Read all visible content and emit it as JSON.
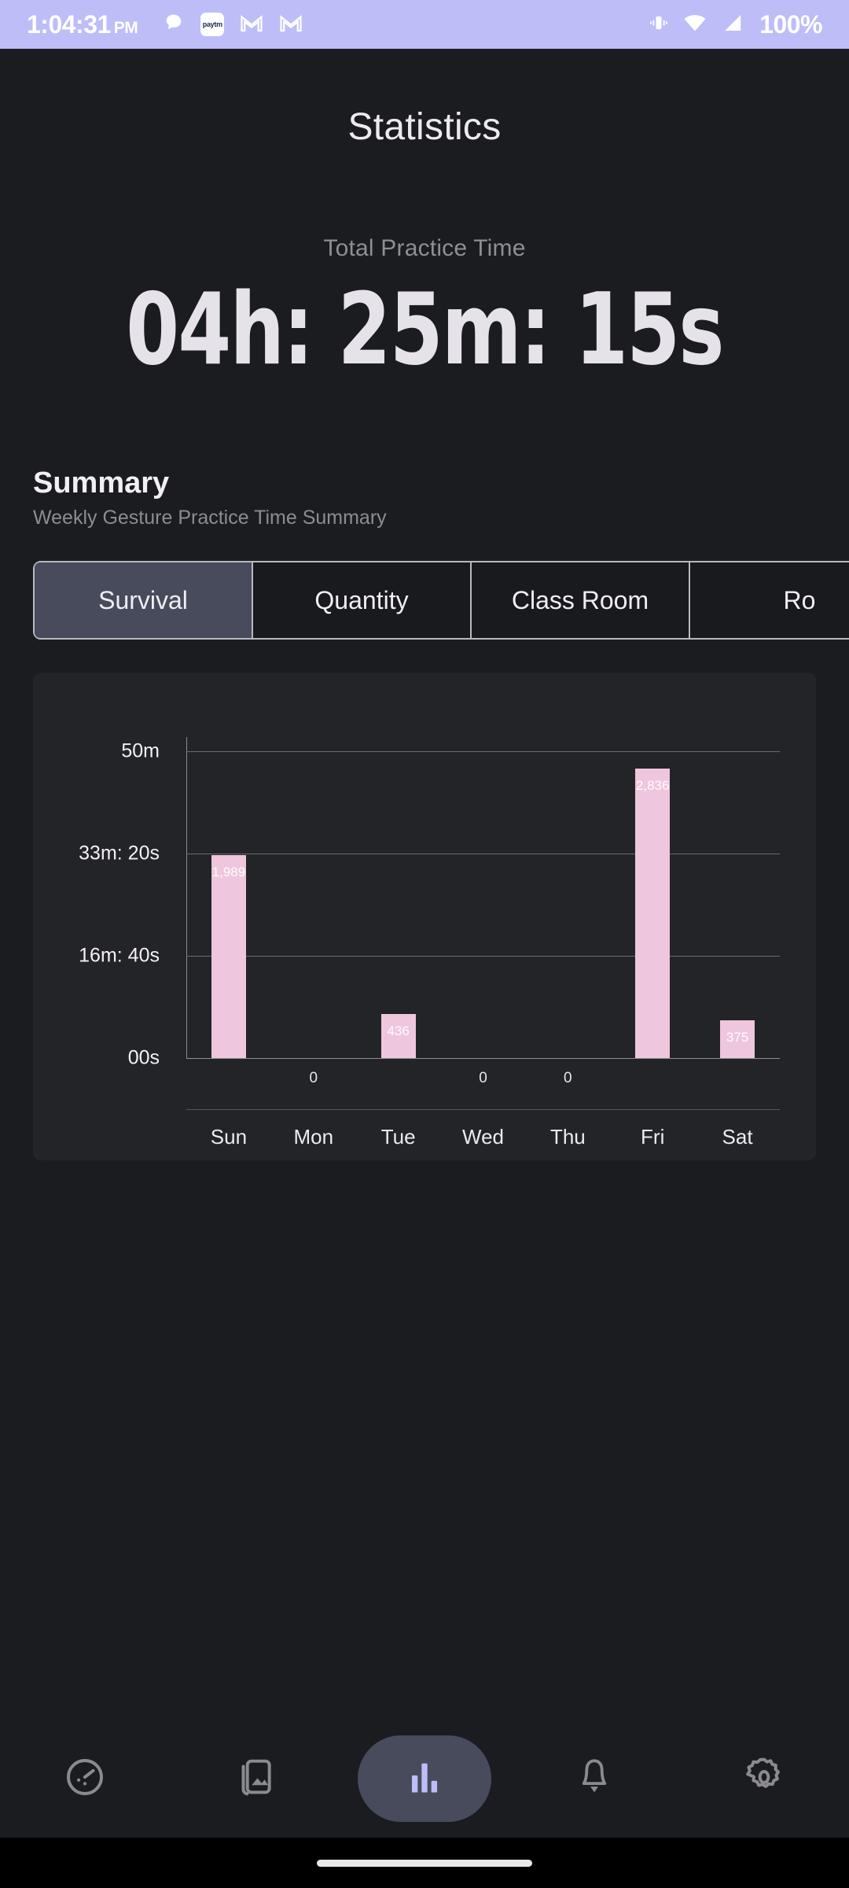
{
  "status_bar": {
    "time": "1:04:31",
    "ampm": "PM",
    "battery": "100%",
    "background_color": "#bdbdf8",
    "icons_left": [
      "chat-bubble-icon",
      "paytm-icon",
      "gmail-icon",
      "gmail-icon"
    ],
    "paytm_label": "paytm",
    "icons_right": [
      "vibrate-icon",
      "wifi-icon",
      "signal-icon"
    ]
  },
  "header": {
    "title": "Statistics"
  },
  "total_practice": {
    "label": "Total Practice Time",
    "value": "04h: 25m: 15s"
  },
  "summary": {
    "title": "Summary",
    "subtitle": "Weekly Gesture Practice Time Summary",
    "tabs": [
      {
        "label": "Survival",
        "active": true
      },
      {
        "label": "Quantity",
        "active": false
      },
      {
        "label": "Class Room",
        "active": false
      },
      {
        "label": "Ro",
        "active": false
      }
    ]
  },
  "chart_data": {
    "type": "bar",
    "title": "Weekly Gesture Practice Time Summary",
    "xlabel": "",
    "ylabel": "",
    "categories": [
      "Sun",
      "Mon",
      "Tue",
      "Wed",
      "Thu",
      "Fri",
      "Sat"
    ],
    "values": [
      1989,
      0,
      436,
      0,
      0,
      2836,
      375
    ],
    "value_labels": [
      "1,989",
      "0",
      "436",
      "0",
      "0",
      "2,836",
      "375"
    ],
    "ylim": [
      0,
      3000
    ],
    "ytick_values": [
      3000,
      2000,
      1000,
      0
    ],
    "ytick_labels": [
      "50m",
      "33m: 20s",
      "16m: 40s",
      "00s"
    ],
    "grid": true,
    "legend": "none",
    "bar_color": "#eec6dd",
    "unit": "seconds"
  },
  "bottom_nav": {
    "items": [
      {
        "icon": "speedometer-icon",
        "active": false
      },
      {
        "icon": "gallery-icon",
        "active": false
      },
      {
        "icon": "bar-chart-icon",
        "active": true
      },
      {
        "icon": "bell-icon",
        "active": false
      },
      {
        "icon": "gear-icon",
        "active": false
      }
    ],
    "active_pill_color": "#474b5c",
    "active_icon_color": "#bdbdf8"
  }
}
